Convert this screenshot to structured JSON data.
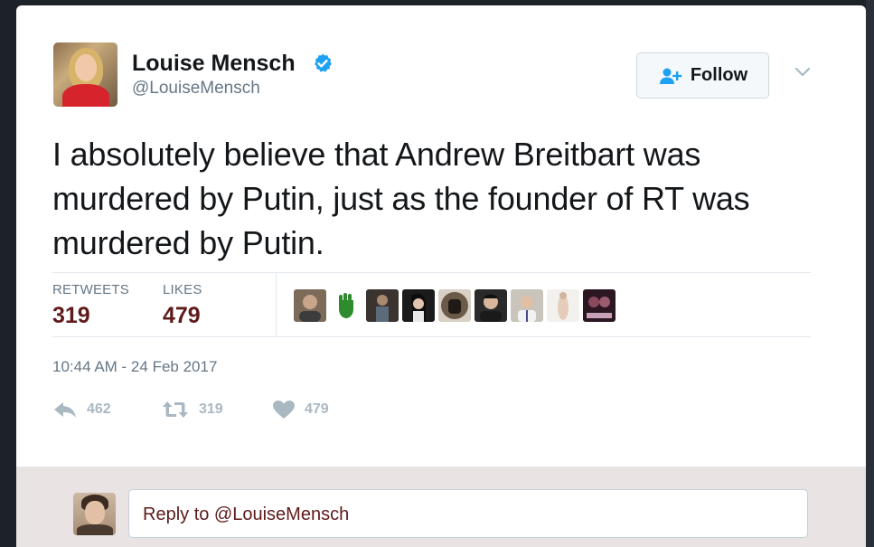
{
  "tweet": {
    "author": {
      "display_name": "Louise Mensch",
      "handle": "@LouiseMensch",
      "verified": true
    },
    "follow_label": "Follow",
    "text": "I absolutely believe that Andrew Breitbart was murdered by Putin, just as the founder of RT was murdered by Putin.",
    "stats": {
      "retweets_label": "RETWEETS",
      "retweets_value": "319",
      "likes_label": "LIKES",
      "likes_value": "479"
    },
    "timestamp": "10:44 AM - 24 Feb 2017",
    "actions": {
      "reply_count": "462",
      "retweet_count": "319",
      "like_count": "479"
    }
  },
  "reply_box": {
    "placeholder": "Reply to @LouiseMensch"
  },
  "colors": {
    "accent_dark_red": "#5f1a1a",
    "verified_blue": "#1da1f2",
    "muted_gray": "#657786",
    "action_gray": "#aab8c2"
  }
}
